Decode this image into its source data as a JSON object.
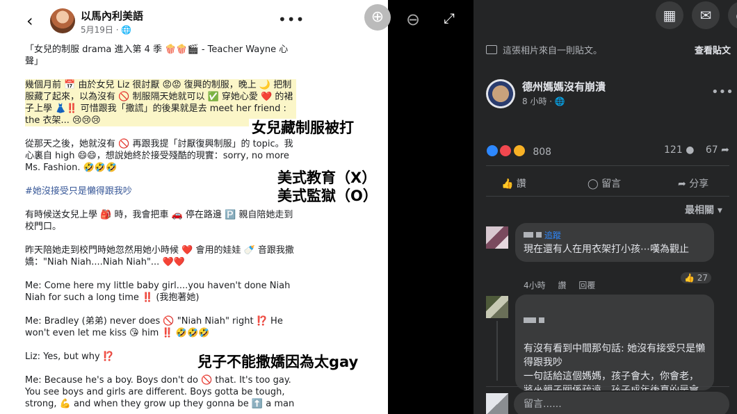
{
  "post": {
    "author": "以馬內利美語",
    "date": "5月19日 · ",
    "more": "•••",
    "back": "‹",
    "paragraphs": [
      "「女兒的制服 drama 進入第 4 季 🍿🍿🎬 - Teacher Wayne 心聲」",
      "幾個月前 📅 由於女兒 Liz 很討厭 😡😡 復興的制服，晚上 🌙 把制服藏了起來，以為沒有 🚫 制服隔天她就可以 ✅ 穿她心愛 ❤️ 的裙子上學 👗‼️ 可惜跟我「撒謊」的後果就是去 meet her friend : the 衣架... 😢😢😢",
      "從那天之後，她就沒有 🚫 再跟我提「討厭復興制服」的 topic。我心裏自 high 😄😄，想說她終於接受殘酷的現實：sorry, no more Ms. Fashion. 🤣🤣🤣",
      "#她沒接受只是懶得跟我吵",
      "有時候送女兒上學 🎒 時，我會把車 🚗 停在路邊 🅿️ 親自陪她走到校門口。",
      "昨天陪她走到校門時她忽然用她小時候 ❤️ 會用的娃娃 🍼 音跟我撒嬌：\"Niah Niah....Niah Niah\"... ❤️❤️",
      "Me: Come here my little baby girl....you haven't done Niah Niah for such a long time ‼️ (我抱著她)",
      "Me: Bradley (弟弟) never does 🚫 \"Niah Niah\" right ⁉️ He won't even let me kiss 😘 him ‼️ 🤣🤣🤣",
      "Liz: Yes, but why ⁉️",
      "Me: Because he's a boy. Boys don't do 🚫 that. It's too gay. You see boys and girls are different. Boys gotta be tough, strong, 💪 and when they grow up they gonna be ⬆️ a man"
    ],
    "captions": [
      "女兒藏制服被打",
      "美式教育（X）",
      "美式監獄（O）",
      "兒子不能撒嬌因為太gay"
    ]
  },
  "viewer": {
    "zoom_in": "⊕",
    "zoom_out": "⊖",
    "expand": "⤢"
  },
  "panel": {
    "notice": "這張相片來自一則貼文。",
    "view_post": "查看貼文",
    "page_name": "德州媽媽沒有崩潰",
    "time": "8 小時 · ",
    "more": "•••",
    "reaction_count": "808",
    "comment_count": "121",
    "share_count": "67",
    "actions": {
      "like": "讚",
      "comment": "留言",
      "share": "分享"
    },
    "sort": "最相關 ▾",
    "comments": [
      {
        "follow": "追蹤",
        "text": "現在還有人在用衣架打小孩⋯嘆為觀止",
        "time": "4小時",
        "like": "讚",
        "reply": "回覆",
        "likes": "27"
      },
      {
        "text": "有沒有看到中間那句話: 她沒有接受只是懶得跟我吵\n一句話給這個媽媽，孩子會大，你會老，將來親子關係疏遠，孩子成年後真的是會躲得遠遠遠遠的"
      }
    ],
    "input_placeholder": "留言......"
  },
  "colors": {
    "panel_bg": "#242526",
    "bubble_bg": "#3a3b3c",
    "link": "#2d88ff"
  }
}
